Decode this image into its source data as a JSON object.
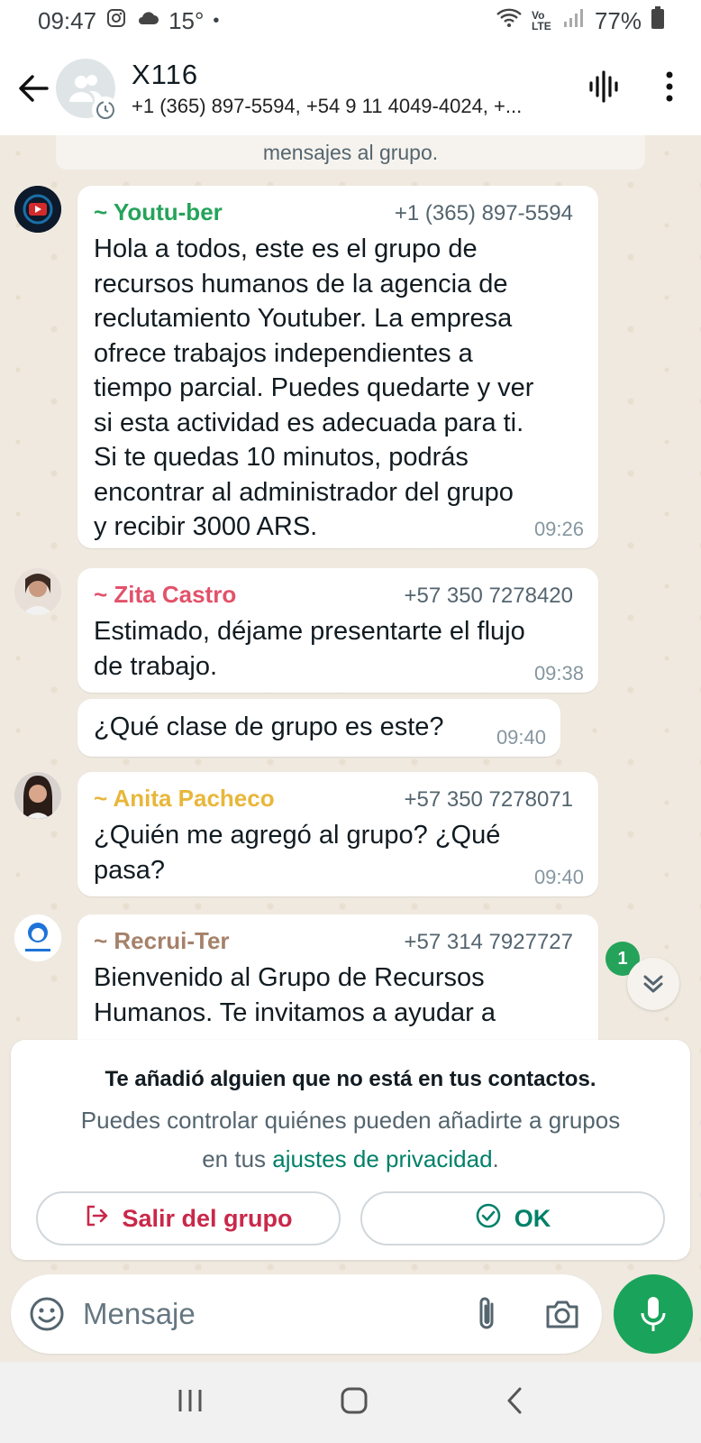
{
  "status_bar": {
    "time": "09:47",
    "temperature": "15°",
    "dot": "•",
    "network_label": "Vo LTE",
    "battery": "77%"
  },
  "header": {
    "title": "X116",
    "subtitle": "+1 (365) 897-5594, +54 9 11 4049-4024, +..."
  },
  "system_note": "mensajes al grupo.",
  "messages": [
    {
      "sender": "~ Youtu-ber",
      "sender_color": "#25a35a",
      "phone": "+1 (365) 897-5594",
      "lines": [
        "Hola a todos, este es el grupo de",
        "recursos humanos de la agencia de",
        "reclutamiento Youtuber. La empresa",
        "ofrece trabajos independientes a",
        "tiempo parcial. Puedes quedarte y ver",
        "si esta actividad es adecuada para ti.",
        "Si te quedas 10 minutos, podrás",
        "encontrar al administrador del grupo",
        "y recibir 3000 ARS."
      ],
      "time": "09:26"
    },
    {
      "sender": "~ Zita Castro",
      "sender_color": "#e2526a",
      "phone": "+57 350 7278420",
      "lines": [
        "Estimado, déjame presentarte el flujo",
        "de trabajo."
      ],
      "time": "09:38"
    },
    {
      "sender": "",
      "phone": "",
      "lines": [
        "¿Qué clase de grupo es este?"
      ],
      "time": "09:40"
    },
    {
      "sender": "~ Anita Pacheco",
      "sender_color": "#e8b73a",
      "phone": "+57 350 7278071",
      "lines": [
        "¿Quién me agregó al grupo? ¿Qué",
        "pasa?"
      ],
      "time": "09:40"
    },
    {
      "sender": "~ Recrui-Ter",
      "sender_color": "#a5816a",
      "phone": "+57 314 7927727",
      "lines": [
        "Bienvenido al Grupo de Recursos",
        "Humanos. Te invitamos a ayudar a"
      ],
      "time": ""
    }
  ],
  "unread_count": "1",
  "notice": {
    "title": "Te añadió alguien que no está en tus contactos.",
    "text_1": "Puedes controlar quiénes pueden añadirte a grupos",
    "text_2_prefix": "en tus ",
    "text_2_link": "ajustes de privacidad",
    "text_2_suffix": ".",
    "leave_label": "Salir del grupo",
    "ok_label": "OK"
  },
  "composer": {
    "placeholder": "Mensaje"
  },
  "colors": {
    "accent": "#008069",
    "green": "#1aa35a",
    "danger": "#c9284a"
  }
}
